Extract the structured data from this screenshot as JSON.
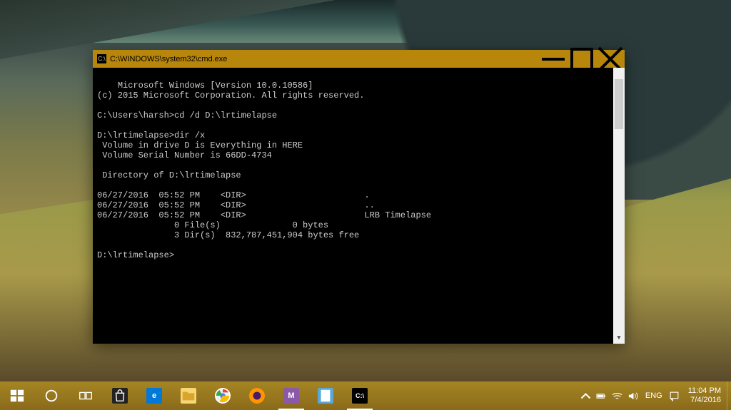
{
  "cmd": {
    "title": "C:\\WINDOWS\\system32\\cmd.exe",
    "icon_text": "C:\\",
    "lines": [
      "Microsoft Windows [Version 10.0.10586]",
      "(c) 2015 Microsoft Corporation. All rights reserved.",
      "",
      "C:\\Users\\harsh>cd /d D:\\lrtimelapse",
      "",
      "D:\\lrtimelapse>dir /x",
      " Volume in drive D is Everything in HERE",
      " Volume Serial Number is 66DD-4734",
      "",
      " Directory of D:\\lrtimelapse",
      "",
      "06/27/2016  05:52 PM    <DIR>                       .",
      "06/27/2016  05:52 PM    <DIR>                       ..",
      "06/27/2016  05:52 PM    <DIR>                       LRB Timelapse",
      "               0 File(s)              0 bytes",
      "               3 Dir(s)  832,787,451,904 bytes free",
      "",
      "D:\\lrtimelapse>"
    ]
  },
  "taskbar": {
    "tray": {
      "lang": "ENG",
      "time": "11:04 PM",
      "date": "7/4/2016"
    }
  }
}
